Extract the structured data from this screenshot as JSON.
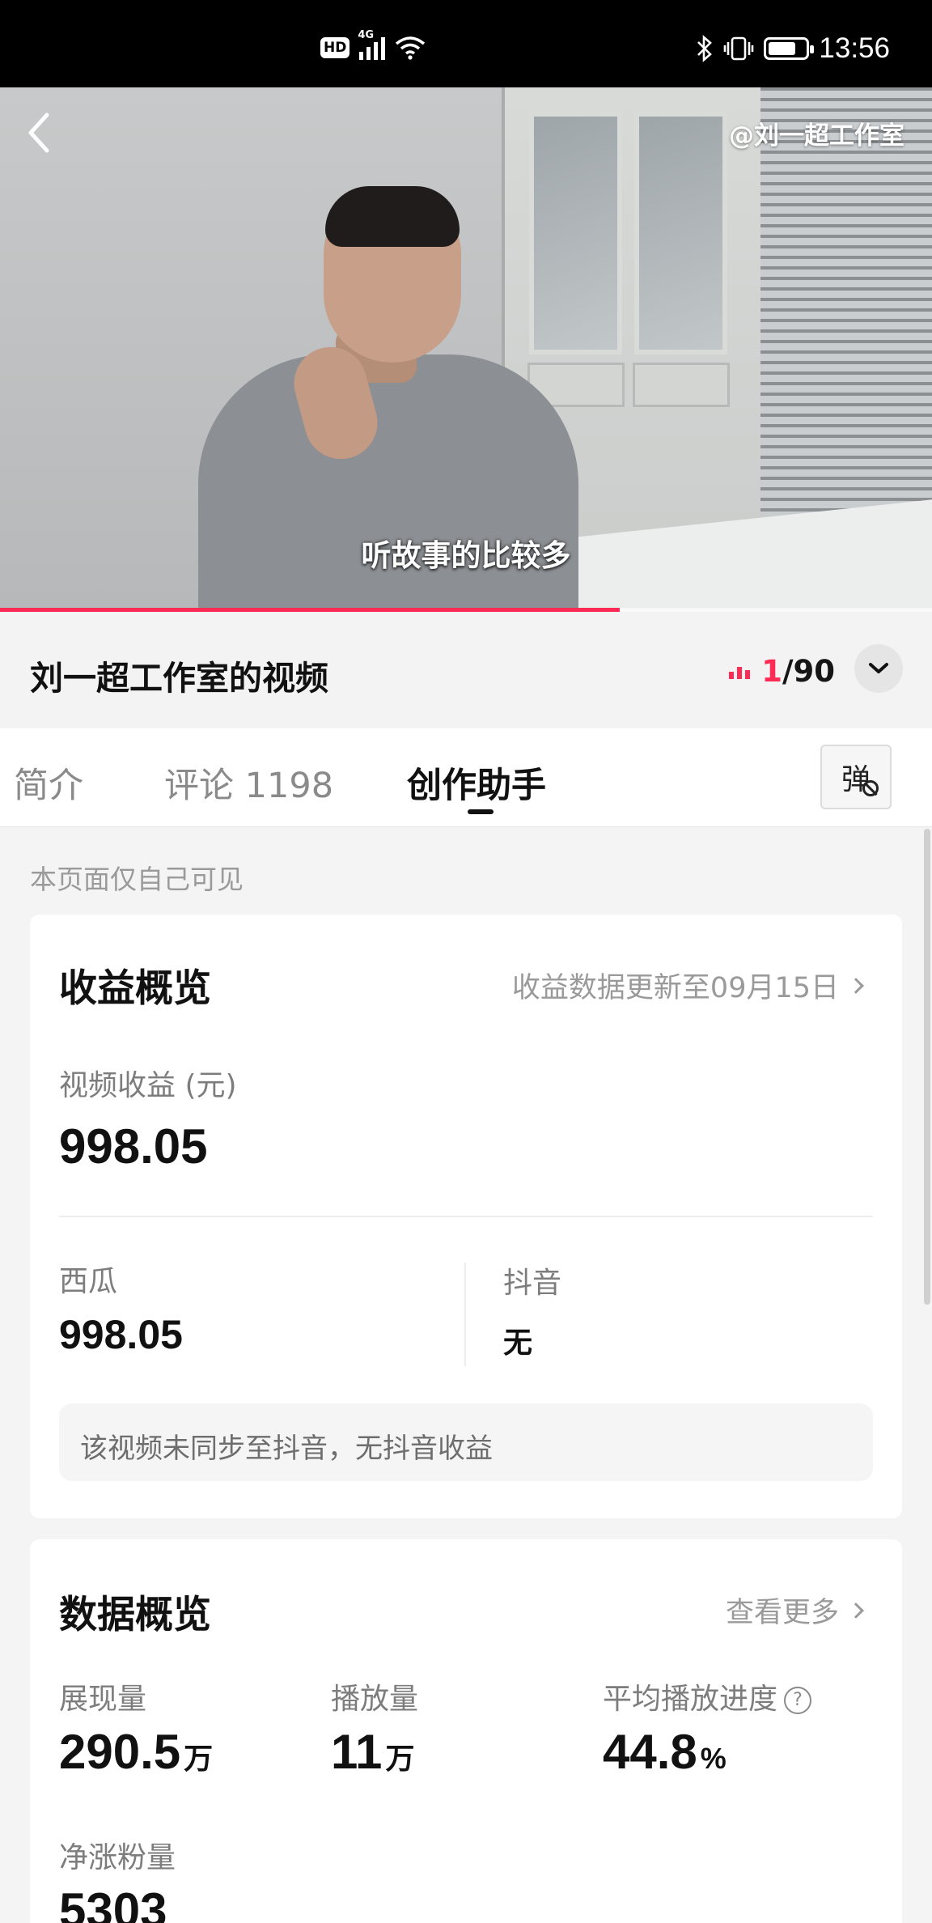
{
  "status_bar": {
    "hd": "HD",
    "network": "4G",
    "time": "13:56",
    "icons": [
      "hd-icon",
      "signal-icon",
      "wifi-icon",
      "bluetooth-icon",
      "vibrate-icon",
      "battery-icon"
    ],
    "battery_level": 0.75
  },
  "video": {
    "watermark": "@刘一超工作室",
    "subtitle": "听故事的比较多",
    "progress": 0.665,
    "accent_color": "#fe2c55"
  },
  "header": {
    "title": "刘一超工作室的视频",
    "episode_current": "1",
    "episode_total": "/90"
  },
  "tabs": [
    {
      "label": "简介"
    },
    {
      "label": "评论 1198"
    },
    {
      "label": "创作助手",
      "active": true
    }
  ],
  "danmaku_button": {
    "label": "弹"
  },
  "privacy_note": "本页面仅自己可见",
  "earnings": {
    "title": "收益概览",
    "update_link": "收益数据更新至09月15日",
    "total_label": "视频收益 (元)",
    "total_value": "998.05",
    "xigua_label": "西瓜",
    "xigua_value": "998.05",
    "douyin_label": "抖音",
    "douyin_value": "无",
    "notice": "该视频未同步至抖音，无抖音收益"
  },
  "stats": {
    "title": "数据概览",
    "more_link": "查看更多",
    "impressions_label": "展现量",
    "impressions_value": "290.5",
    "impressions_unit": "万",
    "plays_label": "播放量",
    "plays_value": "11",
    "plays_unit": "万",
    "avg_progress_label": "平均播放进度",
    "avg_progress_value": "44.8",
    "avg_progress_unit": "%",
    "followers_label": "净涨粉量",
    "followers_value": "5303"
  }
}
